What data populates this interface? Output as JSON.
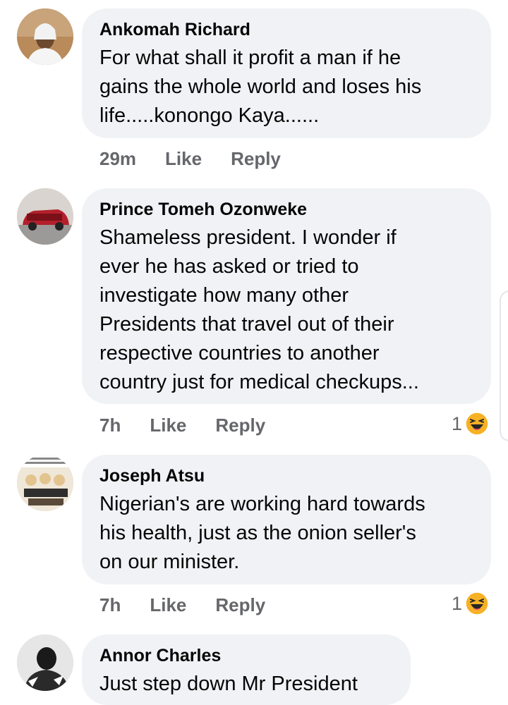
{
  "comments": [
    {
      "author": "Ankomah Richard",
      "lines": [
        "For what shall it profit a man if he",
        "gains the whole world and loses his",
        "life.....konongo Kaya......"
      ],
      "time": "29m",
      "like_label": "Like",
      "reply_label": "Reply"
    },
    {
      "author": "Prince Tomeh Ozonweke",
      "lines": [
        "Shameless president. I wonder if",
        "ever he has asked or tried to",
        "investigate how many other",
        "Presidents that travel out of their",
        "respective countries to another",
        "country just for medical checkups..."
      ],
      "time": "7h",
      "like_label": "Like",
      "reply_label": "Reply",
      "reaction_count": "1",
      "reaction_icon": "haha-emoji-icon"
    },
    {
      "author": "Joseph Atsu",
      "lines": [
        "Nigerian's are working hard towards",
        "his health, just as the onion seller's",
        "on our minister."
      ],
      "time": "7h",
      "like_label": "Like",
      "reply_label": "Reply",
      "reaction_count": "1",
      "reaction_icon": "haha-emoji-icon"
    },
    {
      "author": "Annor Charles",
      "lines": [
        "Just step down Mr President"
      ]
    }
  ],
  "colors": {
    "bubble": "#f0f2f5",
    "meta_text": "#65676b",
    "emoji_face": "#f7b125"
  }
}
